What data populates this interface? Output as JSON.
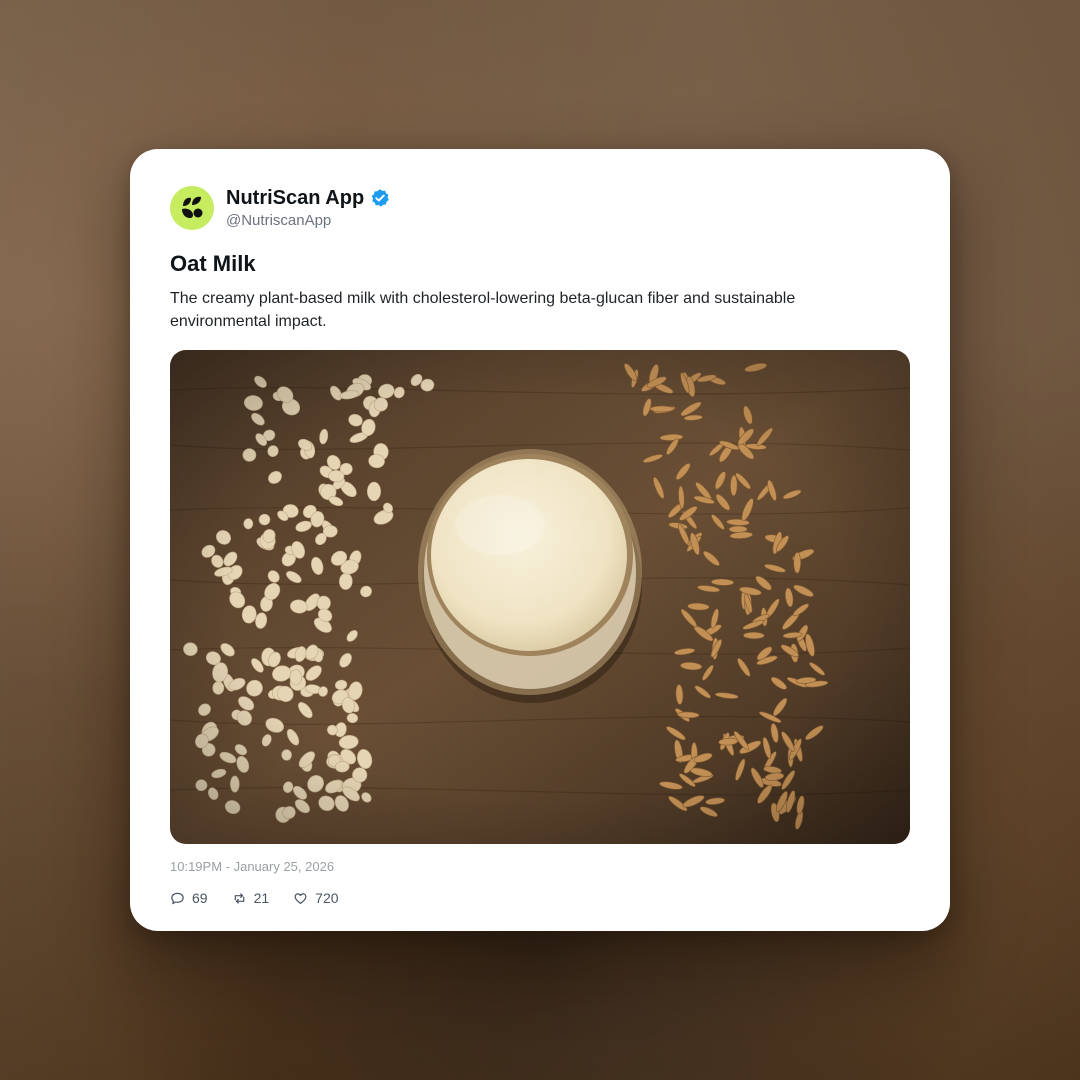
{
  "post": {
    "author": {
      "display_name": "NutriScan App",
      "handle": "@NutriscanApp",
      "verified": true,
      "avatar_color": "#c6ec5f",
      "avatar_icon": "sprout-logo-icon",
      "verified_color": "#1d9bf0"
    },
    "title": "Oat Milk",
    "description": "The creamy plant-based milk with cholesterol-lowering beta-glucan fiber and sustainable environmental impact.",
    "image": {
      "subject": "glass-of-oat-milk-with-oats-and-grains-on-wood"
    },
    "timestamp": "10:19PM - January 25, 2026",
    "stats": {
      "replies": "69",
      "reposts": "21",
      "likes": "720"
    }
  }
}
